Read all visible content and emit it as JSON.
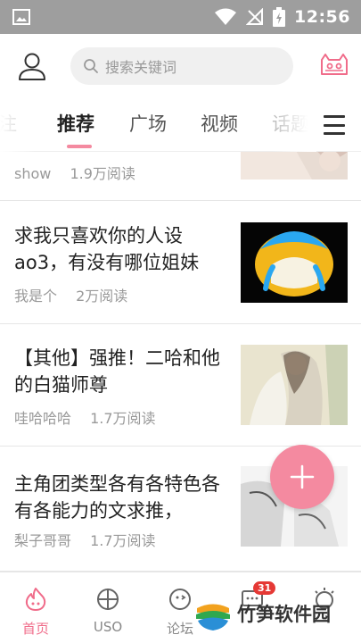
{
  "status_bar": {
    "time": "12:56"
  },
  "header": {
    "search_placeholder": "搜索关键词"
  },
  "tabs": [
    {
      "label": "注"
    },
    {
      "label": "推荐"
    },
    {
      "label": "广场"
    },
    {
      "label": "视频"
    },
    {
      "label": "话题"
    }
  ],
  "feed": [
    {
      "title": "",
      "author": "show",
      "reads": "1.9万阅读"
    },
    {
      "title": "求我只喜欢你的人设ao3，有没有哪位姐妹",
      "author": "我是个",
      "reads": "2万阅读"
    },
    {
      "title": "【其他】强推！二哈和他的白猫师尊",
      "author": "哇哈哈哈",
      "reads": "1.7万阅读"
    },
    {
      "title": "主角团类型各有各特色各有各能力的文求推，",
      "author": "梨子哥哥",
      "reads": "1.7万阅读"
    }
  ],
  "bottom_nav": [
    {
      "label": "首页",
      "active": true
    },
    {
      "label": "USO"
    },
    {
      "label": "论坛"
    },
    {
      "label": "",
      "badge": "31"
    },
    {
      "label": ""
    }
  ],
  "watermark": {
    "text": "竹笋软件园"
  },
  "colors": {
    "accent": "#f48aa0",
    "active_label": "#f06c8a",
    "badge": "#e53935"
  }
}
